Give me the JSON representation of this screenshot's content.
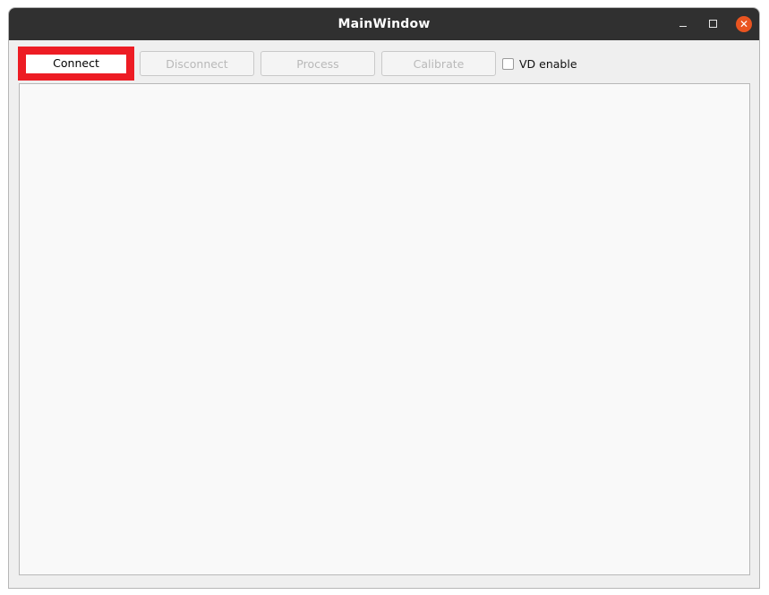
{
  "window": {
    "title": "MainWindow",
    "controls": {
      "minimize_icon": "minimize-icon",
      "maximize_icon": "maximize-icon",
      "close_icon": "close-icon",
      "close_color": "#e95420"
    }
  },
  "toolbar": {
    "connect_label": "Connect",
    "disconnect_label": "Disconnect",
    "process_label": "Process",
    "calibrate_label": "Calibrate",
    "vd_enable_label": "VD enable",
    "vd_enable_checked": false,
    "highlight_color": "#ed1c24"
  }
}
